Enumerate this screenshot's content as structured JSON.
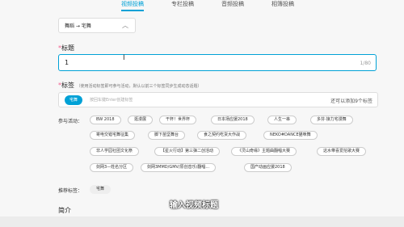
{
  "tabs": [
    {
      "label": "视频投稿",
      "active": true
    },
    {
      "label": "专栏投稿",
      "active": false
    },
    {
      "label": "音频投稿",
      "active": false
    },
    {
      "label": "相簿投稿",
      "active": false
    }
  ],
  "category": {
    "value": "舞蹈 → 宅舞",
    "chevron": "chevron-up-icon"
  },
  "title_field": {
    "label": "标题",
    "required_mark": "*",
    "value": "1",
    "counter": "1/80"
  },
  "tags_field": {
    "label": "标签",
    "required_mark": "*",
    "hint": "（使用活动标签即可参与活动，默认以前三个标签同步生成动态话题）",
    "chip": "宅舞",
    "placeholder": "按回车键Enter创建标签",
    "remaining": "还可以添加9个标签"
  },
  "activity": {
    "label": "参与活动：",
    "rows": [
      [
        "BW 2018",
        "逛漫展",
        "干杯！世界杯",
        "日本场应援2018",
        "人生一串",
        "多芬·接力宅漫舞"
      ],
      [
        "寄电交错宅舞征集",
        "脚下苗坚舞台",
        "食之契约吃货大作战",
        "NEKO#DANCE猫咪舞"
      ],
      [
        "非人学园社团文化祭",
        "【星火行动】第三弹二创活动",
        "《灵山奇缘》主题曲翻唱大赛",
        "这水带喜爱挖歌大赛"
      ],
      [
        "剑网3—姓名分区",
        "剑网3MMD/GMV/原创音乐/翻唱...",
        "国产动画应援2018"
      ]
    ]
  },
  "recommended": {
    "label": "推荐标签：",
    "tag": "宅舞"
  },
  "intro_label": "简介",
  "subtitle_overlay": "输入视频标题",
  "cursor_glyph": "I"
}
